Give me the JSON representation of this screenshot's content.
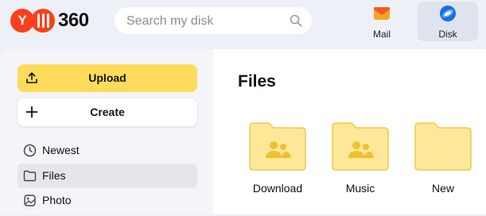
{
  "header": {
    "logo_text": "360",
    "logo_letter": "Y",
    "search": {
      "placeholder": "Search my disk"
    },
    "apps": [
      {
        "label": "Mail",
        "icon": "mail-icon"
      },
      {
        "label": "Disk",
        "icon": "disk-icon",
        "active": true
      }
    ]
  },
  "sidebar": {
    "upload_label": "Upload",
    "create_label": "Create",
    "nav": [
      {
        "label": "Newest",
        "icon": "clock-icon"
      },
      {
        "label": "Files",
        "icon": "folder-icon",
        "active": true
      },
      {
        "label": "Photo",
        "icon": "photo-icon"
      }
    ]
  },
  "main": {
    "title": "Files",
    "folders": [
      {
        "label": "Download",
        "icon": "shared-folder-icon"
      },
      {
        "label": "Music",
        "icon": "shared-folder-icon"
      },
      {
        "label": "New",
        "icon": "folder-icon"
      }
    ]
  },
  "colors": {
    "accent": "#fedb5a",
    "folder_fill": "#fde89a",
    "folder_stroke": "#f0c94a",
    "logo_red": "#fc3f1d"
  }
}
